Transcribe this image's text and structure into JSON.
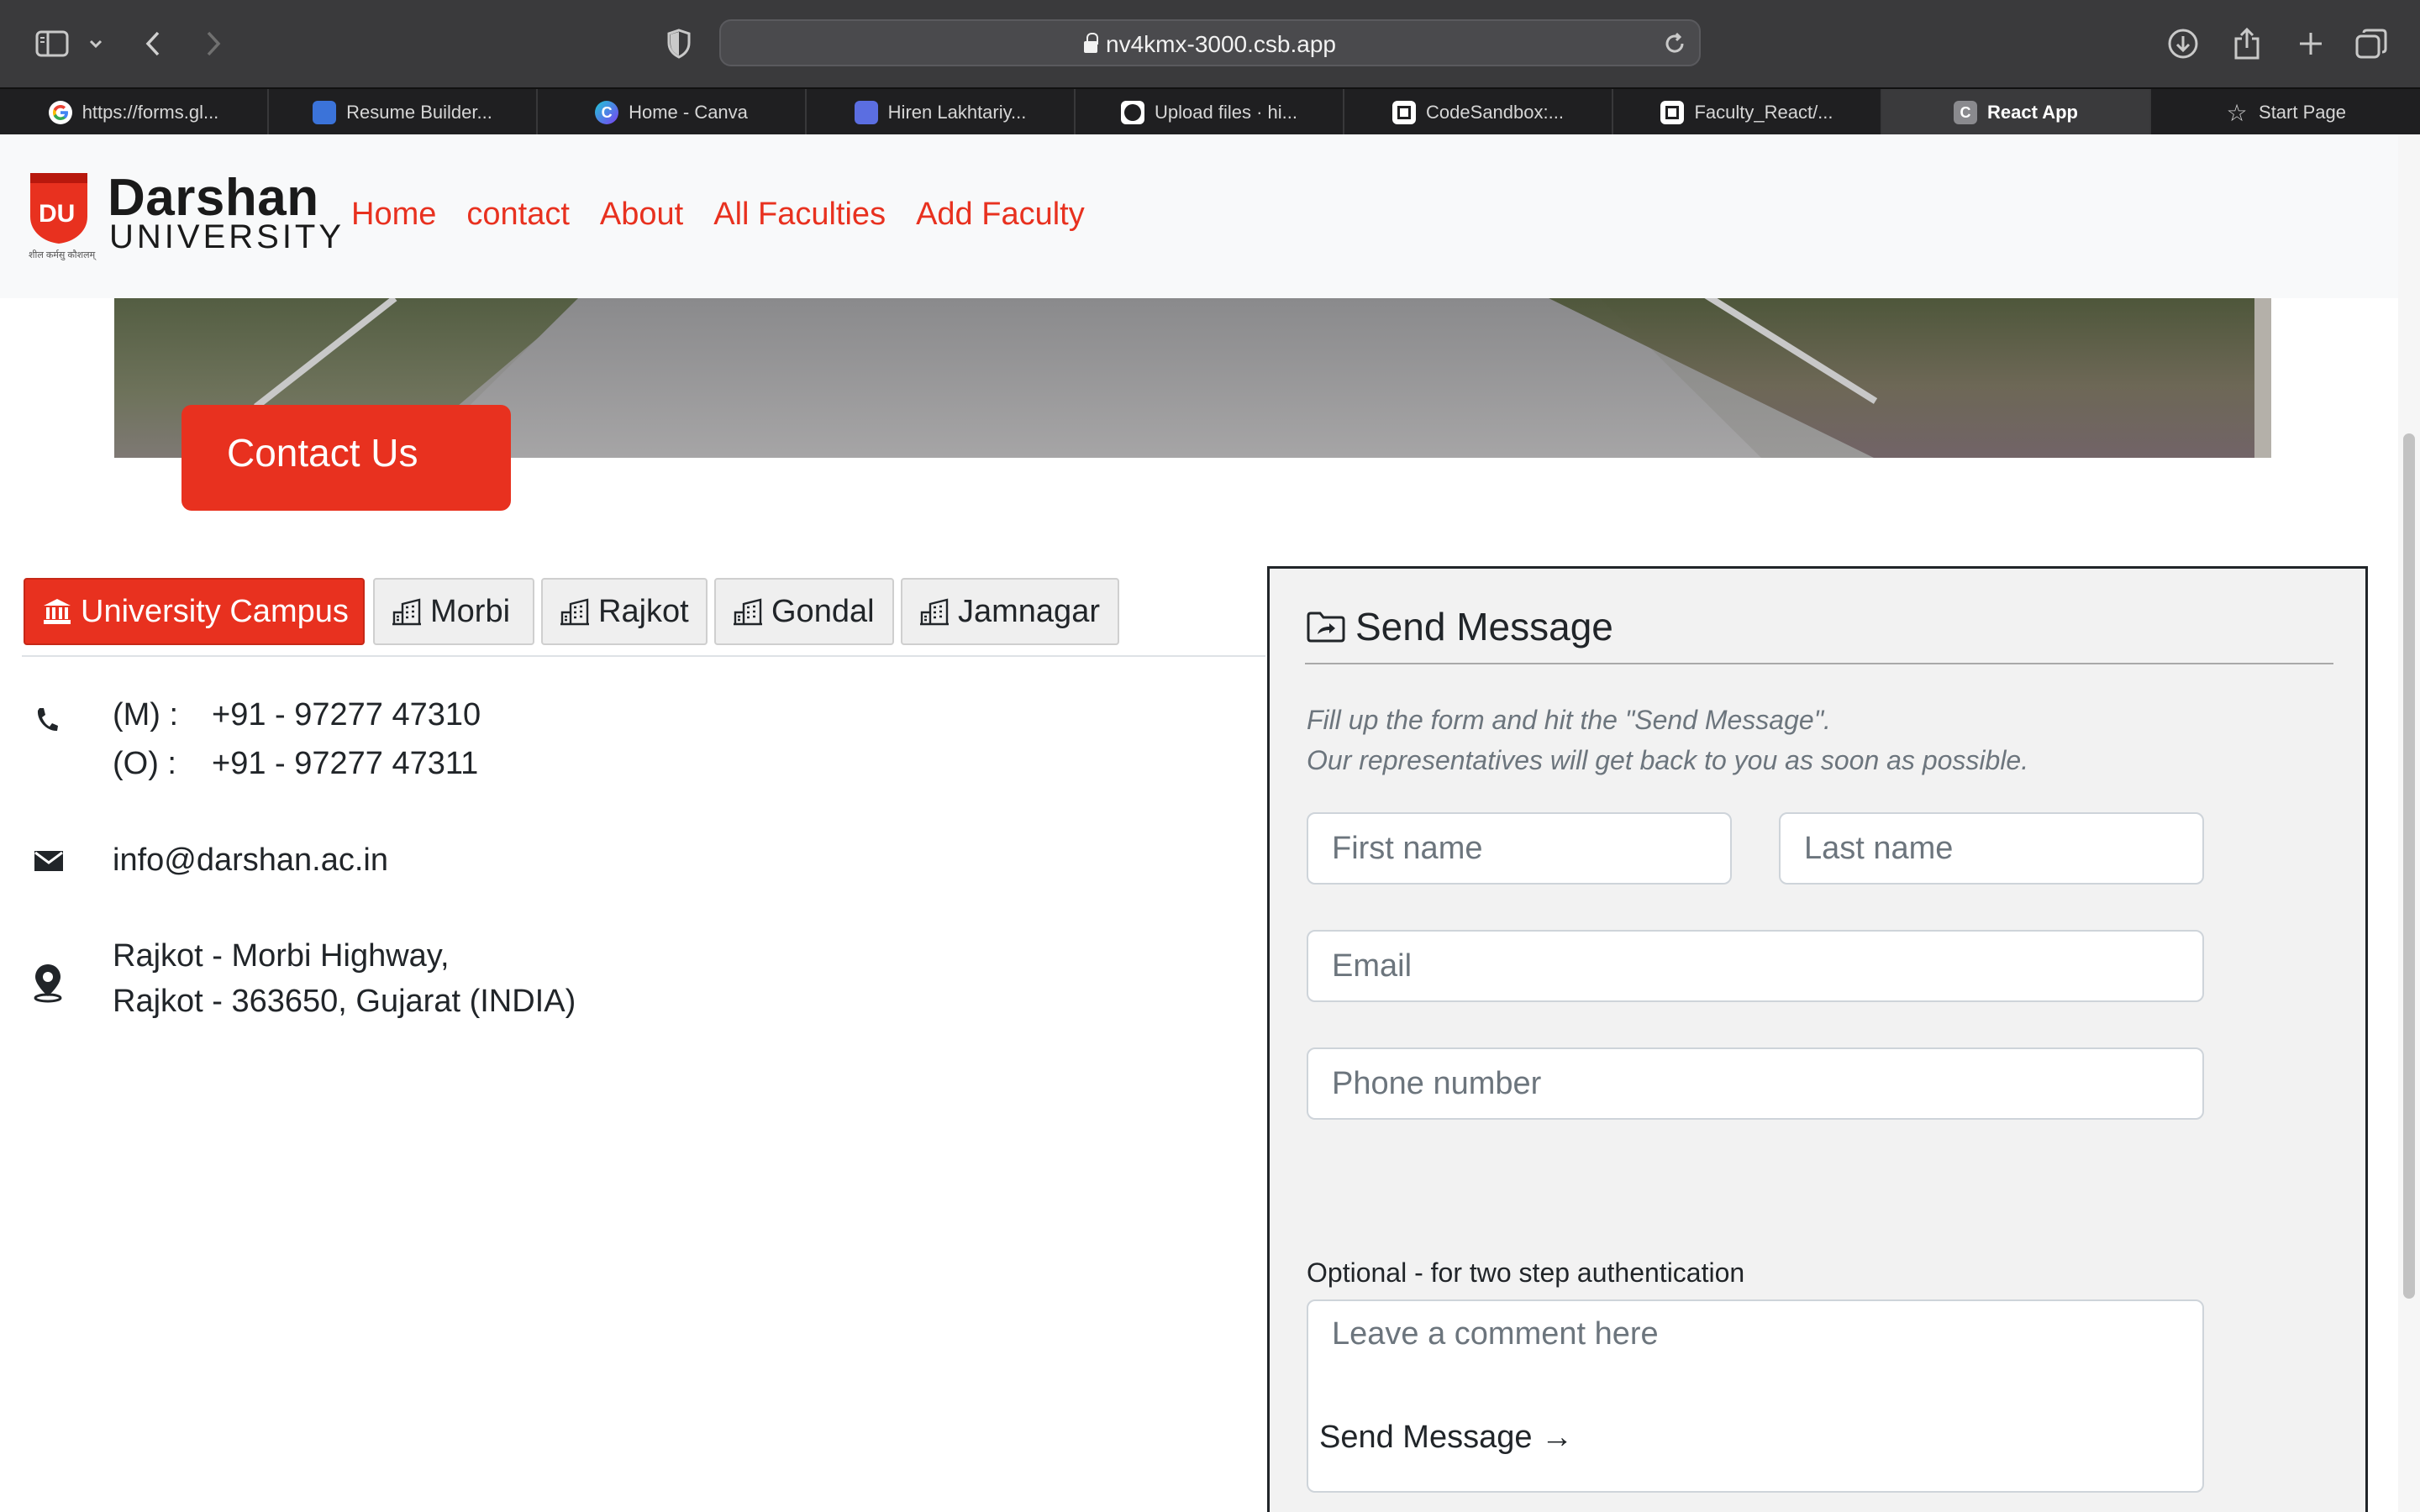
{
  "browser": {
    "url": "nv4kmx-3000.csb.app",
    "tabs": [
      {
        "label": "https://forms.gl...",
        "icon": "google-icon"
      },
      {
        "label": "Resume Builder...",
        "icon": "resume-builder-icon"
      },
      {
        "label": "Home - Canva",
        "icon": "canva-icon"
      },
      {
        "label": "Hiren Lakhtariy...",
        "icon": "printer-icon"
      },
      {
        "label": "Upload files · hi...",
        "icon": "github-icon"
      },
      {
        "label": "CodeSandbox:...",
        "icon": "codesandbox-icon"
      },
      {
        "label": "Faculty_React/...",
        "icon": "codesandbox-icon"
      },
      {
        "label": "React App",
        "icon": "react-app-icon",
        "fav_letter": "C",
        "active": true
      },
      {
        "label": "Start Page",
        "icon": "star-icon"
      }
    ]
  },
  "site": {
    "logo": {
      "line1": "Darshan",
      "line2": "UNIVERSITY",
      "tagline": "शील कर्मसु कौशलम्"
    },
    "nav": [
      "Home",
      "contact",
      "About",
      "All Faculties",
      "Add Faculty"
    ],
    "accent_color": "#e8311f"
  },
  "contact_badge": "Contact Us",
  "campus_tabs": [
    "University Campus",
    "Morbi",
    "Rajkot",
    "Gondal",
    "Jamnagar"
  ],
  "contact": {
    "mobile_label": "(M) :",
    "mobile": "+91 - 97277 47310",
    "office_label": "(O) :",
    "office": "+91 - 97277 47311",
    "email": "info@darshan.ac.in",
    "address_line1": "Rajkot - Morbi Highway,",
    "address_line2": "Rajkot - 363650, Gujarat (INDIA)"
  },
  "form": {
    "title": "Send Message",
    "desc_line1": "Fill up the form and hit the \"Send Message\".",
    "desc_line2": "Our representatives will get back to you as soon as possible.",
    "first_name_placeholder": "First name",
    "last_name_placeholder": "Last name",
    "email_placeholder": "Email",
    "phone_placeholder": "Phone number",
    "phone_hint": "Optional - for two step authentication",
    "comment_placeholder": "Leave a comment here",
    "submit_label": "Send Message →"
  }
}
